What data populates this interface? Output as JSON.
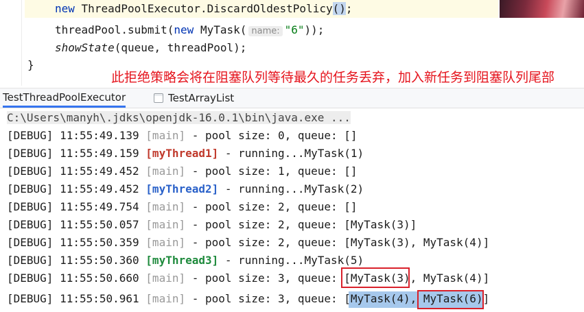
{
  "editor": {
    "line1": {
      "kw_new": "new",
      "text": "ThreadPoolExecutor.DiscardOldestPolicy",
      "parens": "()",
      "end": ";"
    },
    "line2": {
      "prefix": "threadPool.submit(",
      "kw_new": "new",
      "cls": "MyTask(",
      "hint": "name:",
      "str": "\"6\"",
      "end": "));"
    },
    "line3": {
      "method": "showState",
      "args": "(queue, threadPool);"
    },
    "brace": "}"
  },
  "annotation": "此拒绝策略会将在阻塞队列等待最久的任务丢弃，加入新任务到阻塞队列尾部",
  "tabs": [
    {
      "label": "TestThreadPoolExecutor"
    },
    {
      "label": "TestArrayList"
    }
  ],
  "console": {
    "path": "C:\\Users\\manyh\\.jdks\\openjdk-16.0.1\\bin\\java.exe ...",
    "lines": [
      {
        "prefix": "[DEBUG] 11:55:49.139 ",
        "thread": "[main]",
        "msg": " - pool size: 0, queue: []"
      },
      {
        "prefix": "[DEBUG] 11:55:49.159 ",
        "thread": "[myThread1]",
        "msg": " - running...MyTask(1)"
      },
      {
        "prefix": "[DEBUG] 11:55:49.452 ",
        "thread": "[main]",
        "msg": " - pool size: 1, queue: []"
      },
      {
        "prefix": "[DEBUG] 11:55:49.452 ",
        "thread": "[myThread2]",
        "msg": " - running...MyTask(2)"
      },
      {
        "prefix": "[DEBUG] 11:55:49.754 ",
        "thread": "[main]",
        "msg": " - pool size: 2, queue: []"
      },
      {
        "prefix": "[DEBUG] 11:55:50.057 ",
        "thread": "[main]",
        "msg": " - pool size: 2, queue: [MyTask(3)]"
      },
      {
        "prefix": "[DEBUG] 11:55:50.359 ",
        "thread": "[main]",
        "msg": " - pool size: 2, queue: [MyTask(3), MyTask(4)]"
      },
      {
        "prefix": "[DEBUG] 11:55:50.360 ",
        "thread": "[myThread3]",
        "msg": " - running...MyTask(5)"
      },
      {
        "prefix": "[DEBUG] 11:55:50.660 ",
        "thread": "[main]",
        "msg": " - pool size: 3, queue: [MyTask(3), MyTask(4)]"
      },
      {
        "prefix": "[DEBUG] 11:55:50.961 ",
        "thread": "[main]",
        "msg": " - pool size: 3, queue: [MyTask(4), MyTask(6)]"
      }
    ]
  }
}
